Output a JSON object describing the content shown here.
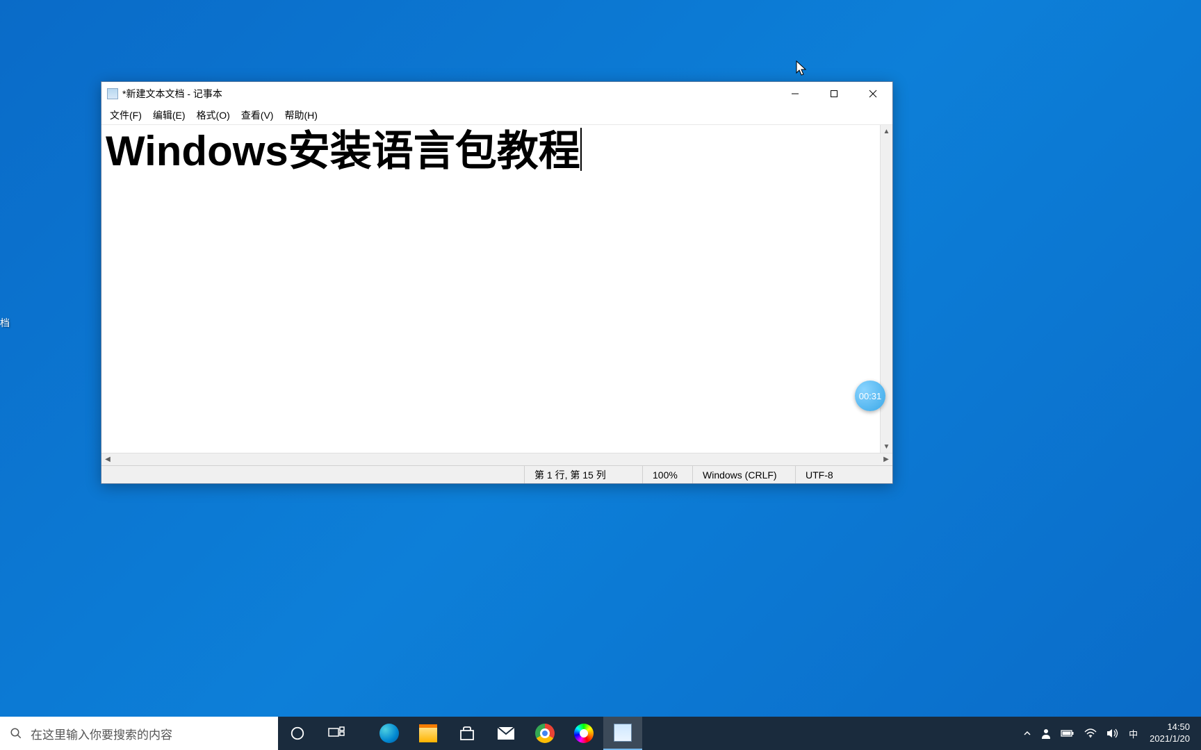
{
  "desktop": {
    "icon_label_fragment": "档"
  },
  "notepad": {
    "title": "*新建文本文档 - 记事本",
    "menu": {
      "file": "文件(F)",
      "edit": "编辑(E)",
      "format": "格式(O)",
      "view": "查看(V)",
      "help": "帮助(H)"
    },
    "content": "Windows安装语言包教程",
    "status": {
      "position": "第 1 行,  第 15 列",
      "zoom": "100%",
      "line_ending": "Windows (CRLF)",
      "encoding": "UTF-8"
    }
  },
  "timer": {
    "value": "00:31"
  },
  "taskbar": {
    "search_placeholder": "在这里输入你要搜索的内容"
  },
  "tray": {
    "ime": "中",
    "time": "14:50",
    "date": "2021/1/20"
  }
}
